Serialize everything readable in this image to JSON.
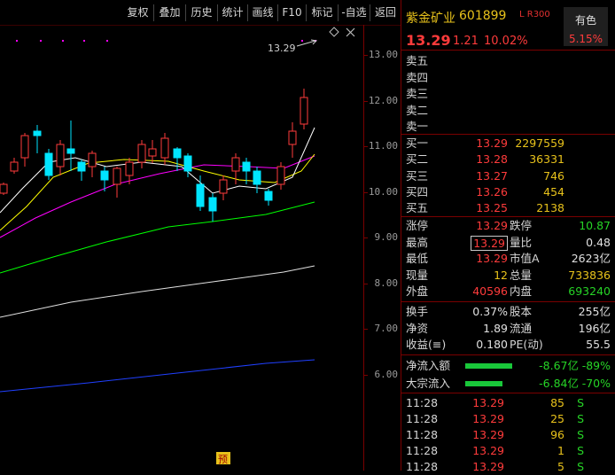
{
  "toolbar": {
    "buttons": [
      "复权",
      "叠加",
      "历史",
      "统计",
      "画线",
      "F10",
      "标记",
      "-自选",
      "返回"
    ]
  },
  "chart": {
    "price_label": "13.29",
    "marker": "预",
    "axis_ticks": [
      "13.00",
      "12.00",
      "11.00",
      "10.00",
      "9.00",
      "8.00",
      "7.00",
      "6.00"
    ],
    "colors": {
      "up": "#ff3b3b",
      "down": "#00e5ff",
      "ma5": "#ffffff",
      "ma10": "#ffff00",
      "ma20": "#ff00ff",
      "ma60": "#00ff00",
      "ma120": "#e0e0e0",
      "ma250": "#2040ff"
    }
  },
  "quote": {
    "name": "紫金矿业",
    "code": "601899",
    "tags": "L R300",
    "color_label": "有色",
    "color_pct": "5.15%",
    "price": "13.29",
    "change": "1.21",
    "change_pct": "10.02%",
    "asks": [
      {
        "label": "卖五",
        "price": "",
        "vol": ""
      },
      {
        "label": "卖四",
        "price": "",
        "vol": ""
      },
      {
        "label": "卖三",
        "price": "",
        "vol": ""
      },
      {
        "label": "卖二",
        "price": "",
        "vol": ""
      },
      {
        "label": "卖一",
        "price": "",
        "vol": ""
      }
    ],
    "bids": [
      {
        "label": "买一",
        "price": "13.29",
        "vol": "2297559"
      },
      {
        "label": "买二",
        "price": "13.28",
        "vol": "36331"
      },
      {
        "label": "买三",
        "price": "13.27",
        "vol": "746"
      },
      {
        "label": "买四",
        "price": "13.26",
        "vol": "454"
      },
      {
        "label": "买五",
        "price": "13.25",
        "vol": "2138"
      }
    ],
    "stats": [
      {
        "l1": "涨停",
        "v1": "13.29",
        "l2": "跌停",
        "v2": "10.87"
      },
      {
        "l1": "最高",
        "v1": "13.29",
        "l2": "量比",
        "v2": "0.48"
      },
      {
        "l1": "最低",
        "v1": "13.29",
        "l2": "市值A",
        "v2": "2623亿"
      },
      {
        "l1": "现量",
        "v1": "12",
        "l2": "总量",
        "v2": "733836"
      },
      {
        "l1": "外盘",
        "v1": "40596",
        "l2": "内盘",
        "v2": "693240"
      }
    ],
    "stats2": [
      {
        "l1": "换手",
        "v1": "0.37%",
        "l2": "股本",
        "v2": "255亿"
      },
      {
        "l1": "净资",
        "v1": "1.89",
        "l2": "流通",
        "v2": "196亿"
      },
      {
        "l1": "收益(≡)",
        "v1": "0.180",
        "l2": "PE(动)",
        "v2": "55.5"
      }
    ],
    "flows": [
      {
        "label": "净流入额",
        "value": "-8.67亿",
        "pct": "-89%",
        "bar": 0.89
      },
      {
        "label": "大宗流入",
        "value": "-6.84亿",
        "pct": "-70%",
        "bar": 0.7
      }
    ],
    "ticks": [
      {
        "time": "11:28",
        "price": "13.29",
        "vol": "85",
        "side": "S"
      },
      {
        "time": "11:28",
        "price": "13.29",
        "vol": "25",
        "side": "S"
      },
      {
        "time": "11:28",
        "price": "13.29",
        "vol": "96",
        "side": "S"
      },
      {
        "time": "11:28",
        "price": "13.29",
        "vol": "1",
        "side": "S"
      },
      {
        "time": "11:28",
        "price": "13.29",
        "vol": "5",
        "side": "S"
      }
    ]
  }
}
